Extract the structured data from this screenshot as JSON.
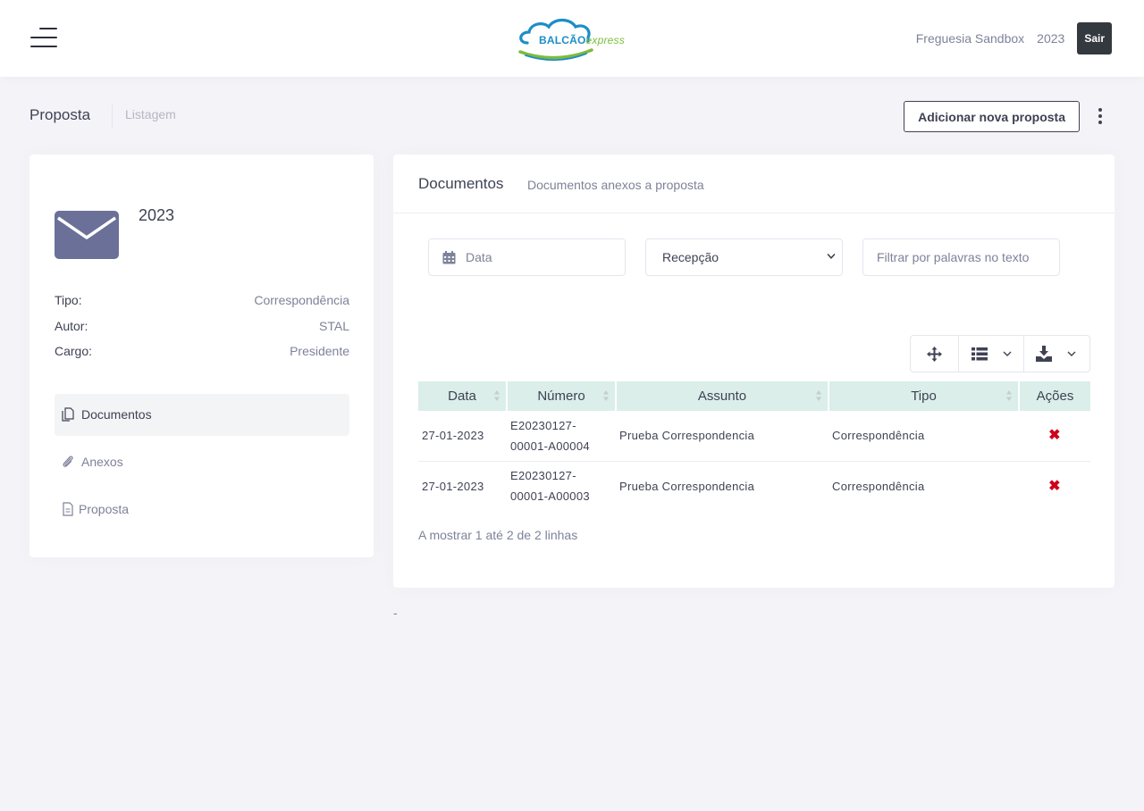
{
  "header": {
    "logo_main": "BALCÃO",
    "logo_sub": "express",
    "entity": "Freguesia Sandbox",
    "year": "2023",
    "logout_label": "Sair"
  },
  "subheader": {
    "title": "Proposta",
    "subtitle": "Listagem",
    "add_label": "Adicionar nova proposta"
  },
  "summary": {
    "year": "2023",
    "fields": [
      {
        "key": "Tipo:",
        "value": "Correspondência"
      },
      {
        "key": "Autor:",
        "value": "STAL"
      },
      {
        "key": "Cargo:",
        "value": "Presidente"
      }
    ],
    "nav": [
      {
        "label": "Documentos",
        "icon": "documents-icon",
        "active": true
      },
      {
        "label": "Anexos",
        "icon": "paperclip-icon",
        "active": false
      },
      {
        "label": "Proposta",
        "icon": "file-icon",
        "active": false
      }
    ]
  },
  "documents": {
    "title": "Documentos",
    "subtitle": "Documentos anexos a proposta",
    "filters": {
      "date_placeholder": "Data",
      "type_selected": "Recepção",
      "text_placeholder": "Filtrar por palavras no texto"
    },
    "toolbar": [
      "move-icon",
      "columns-list-icon",
      "download-icon"
    ],
    "columns": [
      "Data",
      "Número",
      "Assunto",
      "Tipo",
      "Ações"
    ],
    "rows": [
      {
        "data": "27-01-2023",
        "numero_1": "E20230127-",
        "numero_2": "00001-A00004",
        "assunto": "Prueba Correspondencia",
        "tipo": "Correspondência",
        "acao": "✖"
      },
      {
        "data": "27-01-2023",
        "numero_1": "E20230127-",
        "numero_2": "00001-A00003",
        "assunto": "Prueba Correspondencia",
        "tipo": "Correspondência",
        "acao": "✖"
      }
    ],
    "info": "A mostrar 1 até 2 de 2 linhas"
  },
  "footer_dash": "-",
  "colors": {
    "accent_dark": "#33393f",
    "header_row": "#dbeee9",
    "envelope": "#6b7099",
    "delete": "#d0021b"
  }
}
